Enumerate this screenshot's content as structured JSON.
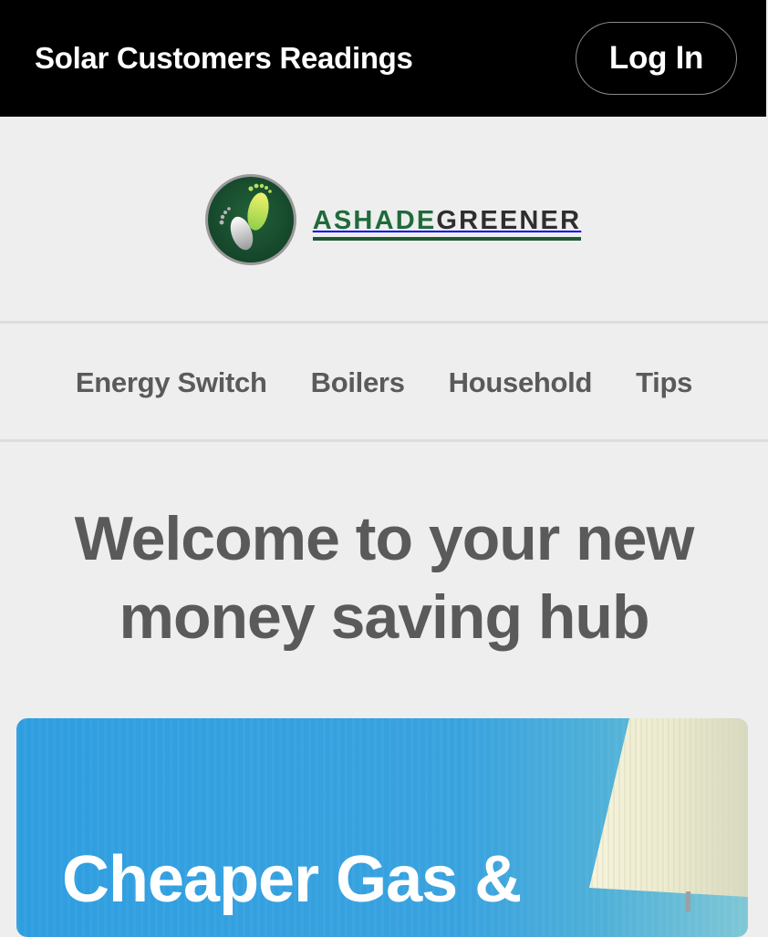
{
  "header": {
    "site_link": "Solar Customers Readings",
    "login_label": "Log In"
  },
  "logo": {
    "word_a": "ASHADE",
    "word_b": "GREENER",
    "icon": "footprints-icon",
    "colors": {
      "badge": "#1a4f2e",
      "wordmark_green": "#1f6b3a",
      "wordmark_dark": "#2e2e2e"
    }
  },
  "nav": {
    "items": [
      "Energy Switch",
      "Boilers",
      "Household",
      "Tips"
    ]
  },
  "hero": {
    "line1": "Welcome to your new",
    "line2": "money saving hub"
  },
  "promo": {
    "heading": "Cheaper Gas &",
    "image": "table-lamp-image",
    "background": "#38a2df"
  },
  "colors": {
    "topbar": "#000000",
    "page_background": "#eeeeee",
    "text": "#5a5a5a"
  }
}
